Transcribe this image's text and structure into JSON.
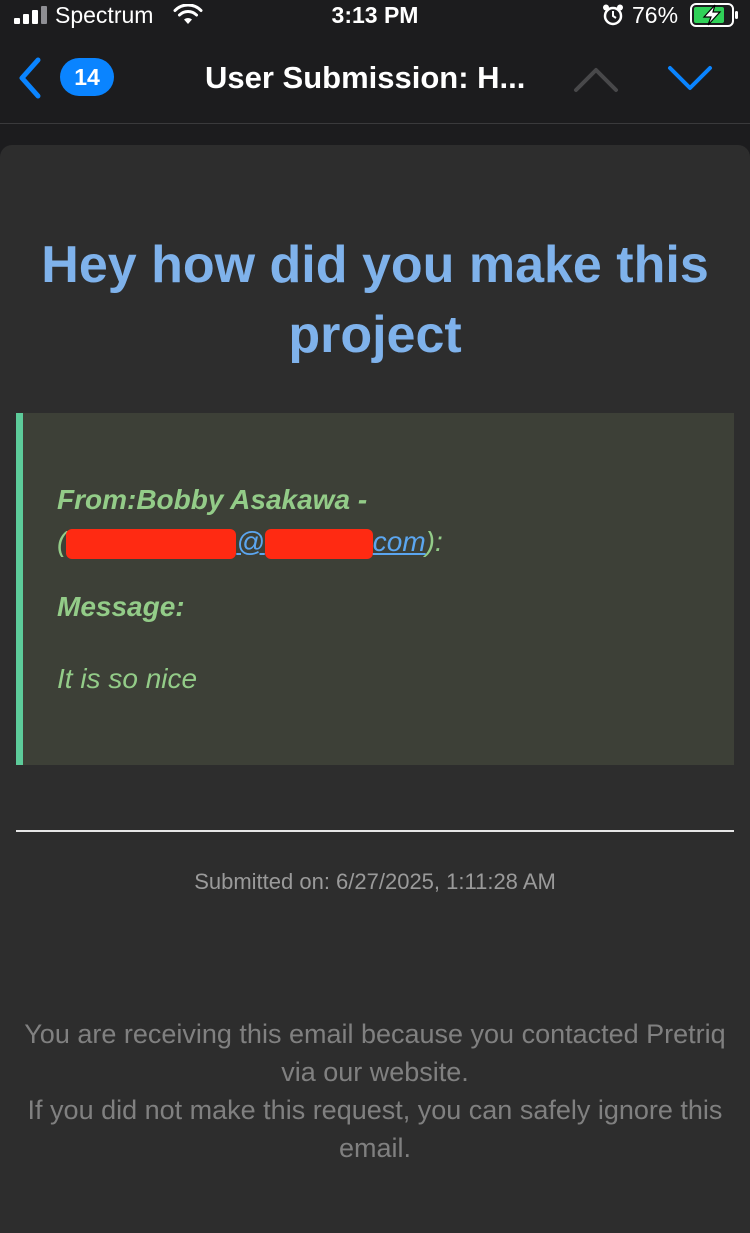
{
  "status_bar": {
    "carrier": "Spectrum",
    "time": "3:13 PM",
    "battery": "76%"
  },
  "nav": {
    "unread_count": "14",
    "title": "User Submission: H..."
  },
  "email": {
    "headline": "Hey how did you make this project",
    "from_label": "From:",
    "from_name": "Bobby Asakawa -",
    "email_open": "(",
    "email_at": "@",
    "email_tld": "com",
    "email_close": "):",
    "message_label": "Message:",
    "message_text": "It is so nice",
    "submitted": "Submitted on: 6/27/2025, 1:11:28 AM",
    "footer_line1": "You are receiving this email because you contacted Pretriq via our website.",
    "footer_line2": "If you did not make this request, you can safely ignore this email."
  },
  "colors": {
    "accent": "#0a84ff",
    "headline": "#7fb2eb",
    "message_text": "#93cc88",
    "message_border": "#5dcb9a",
    "redaction": "#ff2a12"
  }
}
